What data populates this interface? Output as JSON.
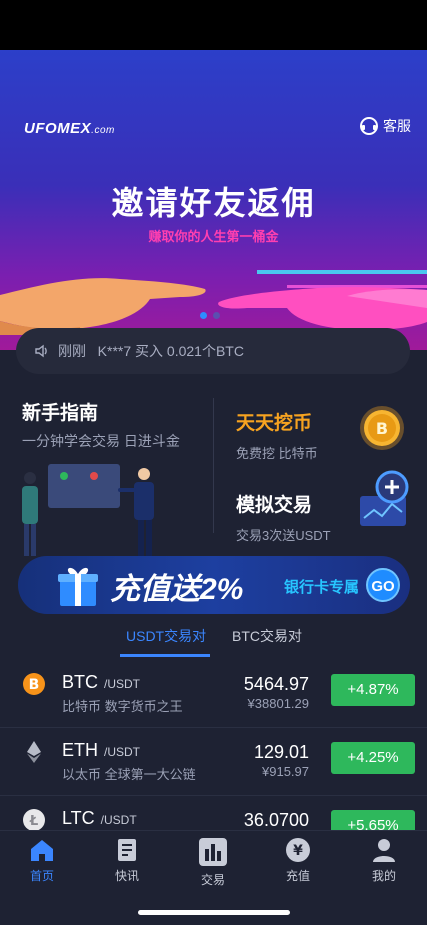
{
  "banner": {
    "logo_main": "UFOMEX",
    "logo_suffix": ".com",
    "service_label": "客服",
    "headline": "邀请好友返佣",
    "subline": "赚取你的人生第一桶金",
    "indicator_count": 2,
    "active_indicator": 0
  },
  "ticker": {
    "text": "刚刚   K***7 买入 0.021个BTC"
  },
  "guide": {
    "title": "新手指南",
    "subtitle": "一分钟学会交易 日进斗金"
  },
  "mining": {
    "title": "天天挖币",
    "subtitle": "免费挖 比特币"
  },
  "simulation": {
    "title": "模拟交易",
    "subtitle": "交易3次送USDT"
  },
  "promo": {
    "big_text": "充值送2%",
    "small_text": "银行卡专属",
    "go_label": "GO"
  },
  "tabs": [
    {
      "label": "USDT交易对",
      "active": true
    },
    {
      "label": "BTC交易对",
      "active": false
    }
  ],
  "market": [
    {
      "symbol": "BTC",
      "quote": "/USDT",
      "desc": "比特币 数字货币之王",
      "price": "5464.97",
      "cny": "¥38801.29",
      "change": "+4.87%",
      "icon": "btc-icon"
    },
    {
      "symbol": "ETH",
      "quote": "/USDT",
      "desc": "以太币 全球第一大公链",
      "price": "129.01",
      "cny": "¥915.97",
      "change": "+4.25%",
      "icon": "eth-icon"
    },
    {
      "symbol": "LTC",
      "quote": "/USDT",
      "desc": "",
      "price": "36.0700",
      "cny": "",
      "change": "+5.65%",
      "icon": "ltc-icon"
    }
  ],
  "tabbar": [
    {
      "label": "首页",
      "icon": "home-icon",
      "active": true
    },
    {
      "label": "快讯",
      "icon": "news-icon",
      "active": false
    },
    {
      "label": "交易",
      "icon": "chart-icon",
      "active": false
    },
    {
      "label": "充值",
      "icon": "yen-icon",
      "active": false
    },
    {
      "label": "我的",
      "icon": "profile-icon",
      "active": false
    }
  ],
  "colors": {
    "accent": "#3b86ff",
    "up": "#2eb85c",
    "mining": "#f7a320",
    "background": "#1e2233"
  }
}
